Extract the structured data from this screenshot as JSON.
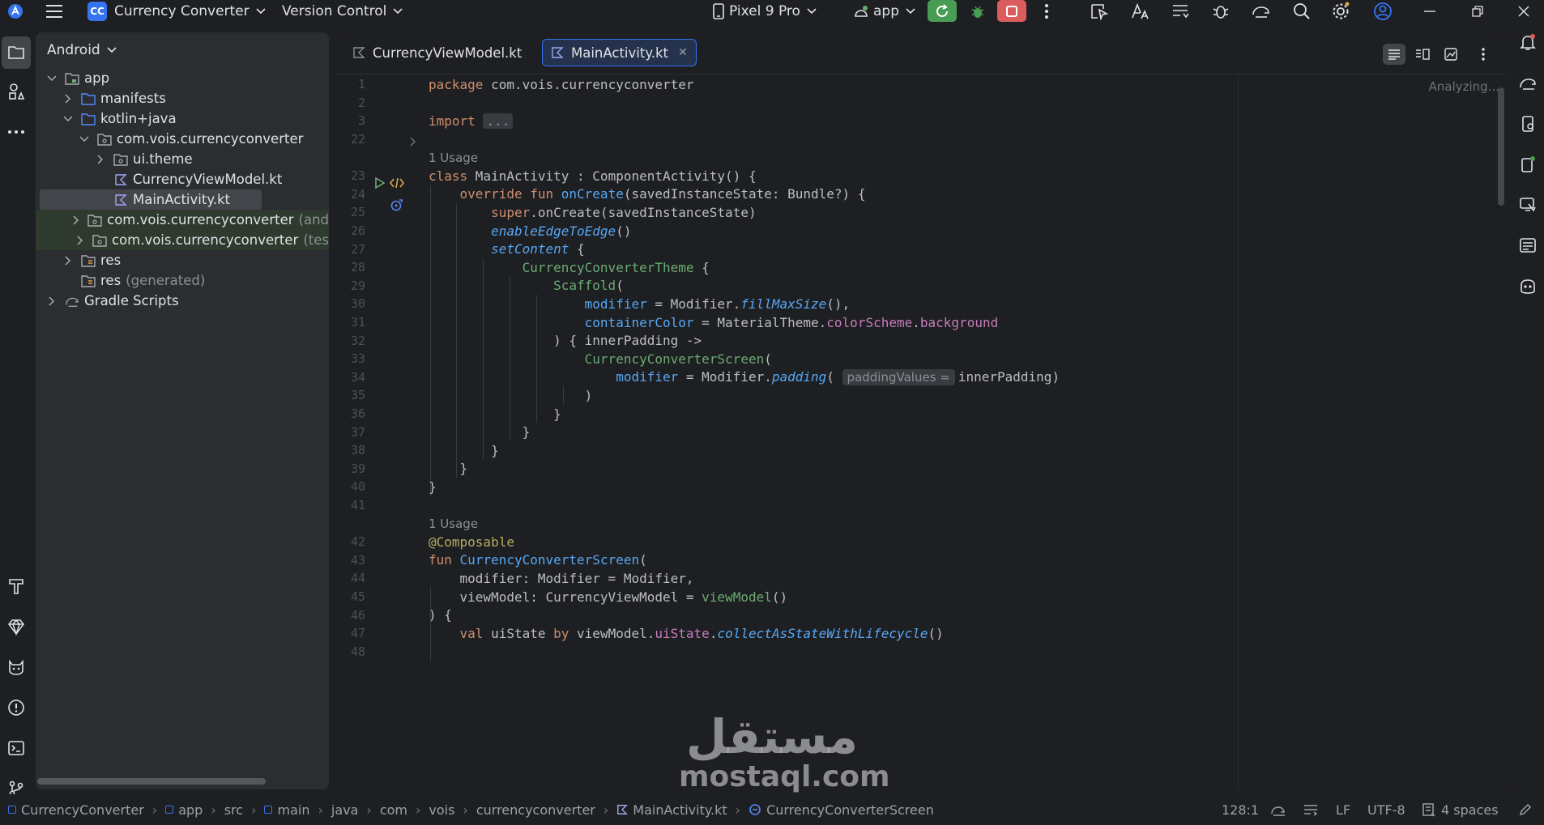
{
  "titlebar": {
    "project_badge": "CC",
    "project_name": "Currency Converter",
    "vcs_label": "Version Control",
    "device": "Pixel 9 Pro",
    "run_config": "app"
  },
  "project_panel": {
    "view_mode": "Android",
    "tree": [
      {
        "label": "app",
        "depth": 0,
        "expanded": true,
        "icon": "module"
      },
      {
        "label": "manifests",
        "depth": 1,
        "expanded": false,
        "icon": "folder"
      },
      {
        "label": "kotlin+java",
        "depth": 1,
        "expanded": true,
        "icon": "folder"
      },
      {
        "label": "com.vois.currencyconverter",
        "depth": 2,
        "expanded": true,
        "icon": "package"
      },
      {
        "label": "ui.theme",
        "depth": 3,
        "expanded": false,
        "icon": "package"
      },
      {
        "label": "CurrencyViewModel.kt",
        "depth": 3,
        "leaf": true,
        "icon": "kotlin"
      },
      {
        "label": "MainActivity.kt",
        "depth": 3,
        "leaf": true,
        "icon": "kotlin",
        "selected": true
      },
      {
        "label": "com.vois.currencyconverter",
        "suffix": "(and",
        "depth": 2,
        "expanded": false,
        "icon": "package",
        "test": true
      },
      {
        "label": "com.vois.currencyconverter",
        "suffix": "(tes",
        "depth": 2,
        "expanded": false,
        "icon": "package",
        "test": true
      },
      {
        "label": "res",
        "depth": 1,
        "expanded": false,
        "icon": "res"
      },
      {
        "label": "res",
        "suffix": "(generated)",
        "depth": 1,
        "leaf": true,
        "icon": "res"
      },
      {
        "label": "Gradle Scripts",
        "depth": 0,
        "expanded": false,
        "icon": "gradle"
      }
    ]
  },
  "editor": {
    "tabs": [
      {
        "label": "CurrencyViewModel.kt",
        "active": false
      },
      {
        "label": "MainActivity.kt",
        "active": true
      }
    ],
    "analyzing": "Analyzing...",
    "lines": [
      {
        "n": "1",
        "html": "<span class=\"kw\">package</span> com.vois.currencyconverter"
      },
      {
        "n": "2",
        "html": ""
      },
      {
        "n": "3",
        "html": "<span class=\"kw\">import</span> <span class=\"fold\">...</span>"
      },
      {
        "n": "22",
        "html": ""
      },
      {
        "usage": "1 Usage"
      },
      {
        "n": "23",
        "html": "<span class=\"kw\">class</span> MainActivity : ComponentActivity() {"
      },
      {
        "n": "24",
        "html": "    <span class=\"kw\">override fun</span> <span class=\"fn\">onCreate</span>(savedInstanceState: Bundle?) {"
      },
      {
        "n": "25",
        "html": "        <span class=\"kw\">super</span>.onCreate(savedInstanceState)"
      },
      {
        "n": "26",
        "html": "        <span class=\"ital\">enableEdgeToEdge</span>()"
      },
      {
        "n": "27",
        "html": "        <span class=\"ital\">setContent</span> {"
      },
      {
        "n": "28",
        "html": "            <span class=\"cls\">CurrencyConverterTheme</span> {"
      },
      {
        "n": "29",
        "html": "                <span class=\"cls\">Scaffold</span>("
      },
      {
        "n": "30",
        "html": "                    <span class=\"fn\">modifier</span> = Modifier.<span class=\"ital\">fillMaxSize</span>(),"
      },
      {
        "n": "31",
        "html": "                    <span class=\"fn\">containerColor</span> = MaterialTheme.<span class=\"prop\">colorScheme</span>.<span class=\"prop\">background</span>"
      },
      {
        "n": "32",
        "html": "                ) { innerPadding -&gt;"
      },
      {
        "n": "33",
        "html": "                    <span class=\"cls\">CurrencyConverterScreen</span>("
      },
      {
        "n": "34",
        "html": "                        <span class=\"fn\">modifier</span> = Modifier.<span class=\"ital\">padding</span>( <span class=\"param-hint\">paddingValues =</span>innerPadding)"
      },
      {
        "n": "35",
        "html": "                    )"
      },
      {
        "n": "36",
        "html": "                }"
      },
      {
        "n": "37",
        "html": "            }"
      },
      {
        "n": "38",
        "html": "        }"
      },
      {
        "n": "39",
        "html": "    }"
      },
      {
        "n": "40",
        "html": "}"
      },
      {
        "n": "41",
        "html": ""
      },
      {
        "usage": "1 Usage"
      },
      {
        "n": "42",
        "html": "<span class=\"ann\">@Composable</span>"
      },
      {
        "n": "43",
        "html": "<span class=\"kw\">fun</span> <span class=\"fn\">CurrencyConverterScreen</span>("
      },
      {
        "n": "44",
        "html": "    modifier: Modifier = Modifier,"
      },
      {
        "n": "45",
        "html": "    viewModel: CurrencyViewModel = <span class=\"cls\">viewModel</span>()"
      },
      {
        "n": "46",
        "html": ") {"
      },
      {
        "n": "47",
        "html": "    <span class=\"kw\">val</span> uiState <span class=\"kw\">by</span> viewModel.<span class=\"prop\">uiState</span>.<span class=\"ital\">collectAsStateWithLifecycle</span>()"
      },
      {
        "n": "48",
        "html": ""
      }
    ]
  },
  "statusbar": {
    "breadcrumbs": [
      "CurrencyConverter",
      "app",
      "src",
      "main",
      "java",
      "com",
      "vois",
      "currencyconverter",
      "MainActivity.kt",
      "CurrencyConverterScreen"
    ],
    "position": "128:1",
    "line_ending": "LF",
    "encoding": "UTF-8",
    "indent": "4 spaces"
  },
  "watermark": {
    "arabic": "مستقل",
    "latin": "mostaql.com"
  },
  "colors": {
    "accent": "#3574f0",
    "run_green": "#499c54",
    "stop_red": "#db5c5c"
  }
}
